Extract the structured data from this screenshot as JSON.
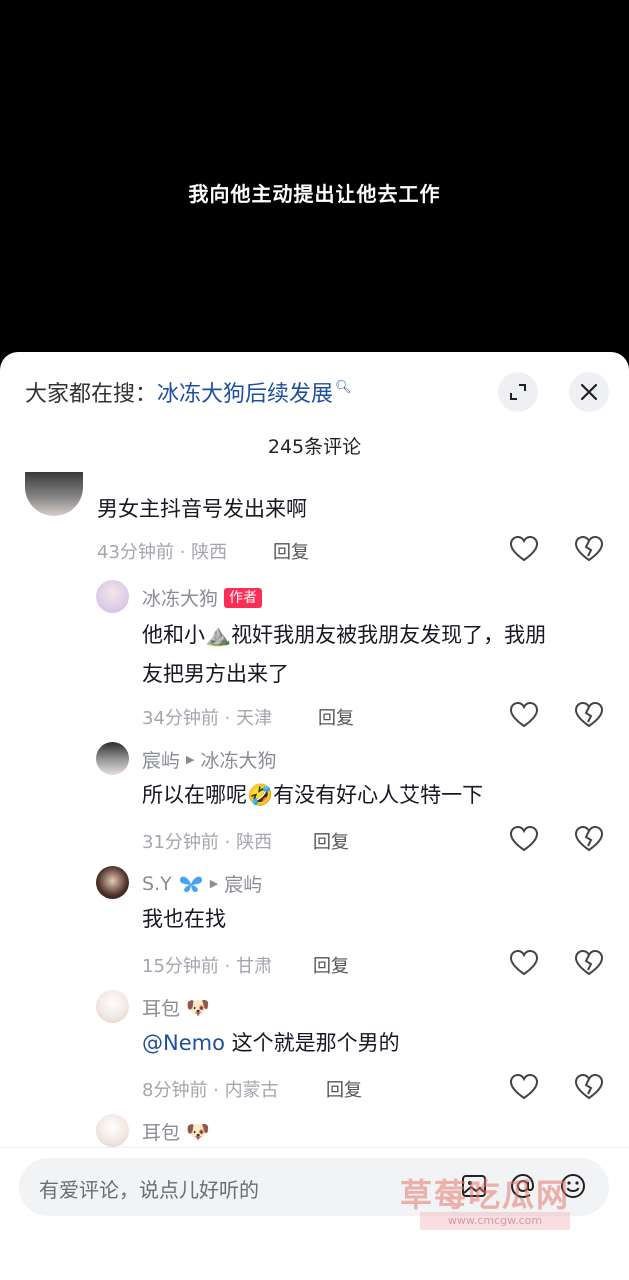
{
  "video": {
    "subtitle": "我向他主动提出让他去工作"
  },
  "header": {
    "search_prefix": "大家都在搜：",
    "search_keyword": "冰冻大狗后续发展",
    "comment_count": "245条评论"
  },
  "comments": [
    {
      "name": "",
      "text": "男女主抖音号发出来啊",
      "meta": "43分钟前 · 陕西",
      "reply": "回复"
    },
    {
      "name": "冰冻大狗",
      "tag": "作者",
      "text_line1": "他和小",
      "text_line1b": "视奸我朋友被我朋友发现了，我朋",
      "text_line2": "友把男方出来了",
      "meta": "34分钟前 · 天津",
      "reply": "回复"
    },
    {
      "name": "宸屿",
      "reply_to": "冰冻大狗",
      "text": "所以在哪呢",
      "text_after": "有没有好心人艾特一下",
      "meta": "31分钟前 · 陕西",
      "reply": "回复"
    },
    {
      "name": "S.Y",
      "reply_to": "宸屿",
      "text": "我也在找",
      "meta": "15分钟前 · 甘肃",
      "reply": "回复"
    },
    {
      "name": "耳包",
      "mention": "@Nemo",
      "text": " 这个就是那个男的",
      "meta": "8分钟前 · 内蒙古",
      "reply": "回复"
    },
    {
      "name": "耳包"
    }
  ],
  "footer": {
    "input_placeholder": "有爱评论，说点儿好听的",
    "watermark": "草莓吃瓜网",
    "watermark_url": "www.cmcgw.com"
  },
  "colors": {
    "accent_link": "#1f4f9e",
    "author_tag": "#ff2d55"
  }
}
